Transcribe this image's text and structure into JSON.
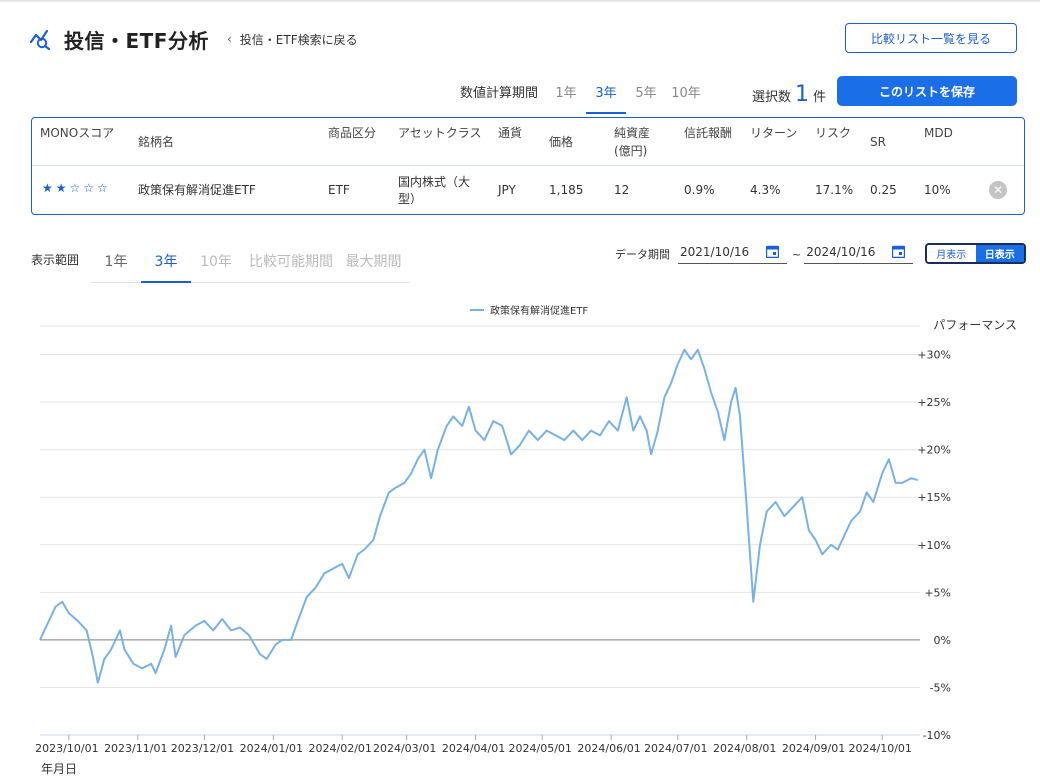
{
  "header": {
    "title": "投信・ETF分析",
    "back_label": "投信・ETF検索に戻る",
    "compare_list_button": "比較リスト一覧を見る"
  },
  "calc_period": {
    "label": "数値計算期間",
    "tabs": [
      "1年",
      "3年",
      "5年",
      "10年"
    ],
    "active": "3年"
  },
  "selection": {
    "label": "選択数",
    "count": "1",
    "unit": "件"
  },
  "save_button": "このリストを保存",
  "table": {
    "headers": {
      "mono_score": "MONOスコア",
      "name": "銘柄名",
      "category": "商品区分",
      "asset_class": "アセットクラス",
      "currency": "通貨",
      "price": "価格",
      "net_assets": "純資産",
      "net_assets_unit": "(億円)",
      "fee": "信託報酬",
      "return": "リターン",
      "risk": "リスク",
      "sr": "SR",
      "mdd": "MDD"
    },
    "rows": [
      {
        "stars": "★★☆☆☆",
        "name": "政策保有解消促進ETF",
        "category": "ETF",
        "asset_class": "国内株式（大型）",
        "currency": "JPY",
        "price": "1,185",
        "net_assets": "12",
        "fee": "0.9%",
        "return": "4.3%",
        "risk": "17.1%",
        "sr": "0.25",
        "mdd": "10%",
        "remove_icon": "close-circle-icon"
      }
    ]
  },
  "range": {
    "label": "表示範囲",
    "tabs": [
      "1年",
      "3年",
      "10年",
      "比較可能期間",
      "最大期間"
    ],
    "active": "3年"
  },
  "data_period": {
    "label": "データ期間",
    "from": "2021/10/16",
    "to": "2024/10/16",
    "separator": "~"
  },
  "view_toggle": {
    "monthly": "月表示",
    "daily": "日表示",
    "active": "daily"
  },
  "colors": {
    "accent": "#1a6ee8",
    "line": "#78b2e5"
  },
  "chart_data": {
    "type": "line",
    "title": "",
    "ylabel": "パフォーマンス",
    "xlabel": "年月日",
    "ylim": [
      -10,
      33
    ],
    "xlim": [
      "2023-09-18",
      "2024-10-18"
    ],
    "y_ticks": [
      30,
      25,
      20,
      15,
      10,
      5,
      0,
      -5,
      -10
    ],
    "y_tick_labels": [
      "+30%",
      "+25%",
      "+20%",
      "+15%",
      "+10%",
      "+5%",
      "0%",
      "-5%",
      "-10%"
    ],
    "x_ticks": [
      "2023-10-01",
      "2023-11-01",
      "2023-12-01",
      "2024-01-01",
      "2024-02-01",
      "2024-03-01",
      "2024-04-01",
      "2024-05-01",
      "2024-06-01",
      "2024-07-01",
      "2024-08-01",
      "2024-09-01",
      "2024-10-01"
    ],
    "x_tick_labels": [
      "2023/10/01",
      "2023/11/01",
      "2023/12/01",
      "2024/01/01",
      "2024/02/01",
      "2024/03/01",
      "2024/04/01",
      "2024/05/01",
      "2024/06/01",
      "2024/07/01",
      "2024/08/01",
      "2024/09/01",
      "2024/10/01"
    ],
    "grid": true,
    "legend_position": "top-center",
    "series": [
      {
        "name": "政策保有解消促進ETF",
        "points": [
          [
            "2023-09-18",
            0.0
          ],
          [
            "2023-09-21",
            1.5
          ],
          [
            "2023-09-25",
            3.5
          ],
          [
            "2023-09-28",
            4.0
          ],
          [
            "2023-10-01",
            2.8
          ],
          [
            "2023-10-05",
            2.0
          ],
          [
            "2023-10-09",
            1.0
          ],
          [
            "2023-10-12",
            -2.0
          ],
          [
            "2023-10-14",
            -4.5
          ],
          [
            "2023-10-17",
            -2.0
          ],
          [
            "2023-10-20",
            -1.0
          ],
          [
            "2023-10-24",
            1.0
          ],
          [
            "2023-10-26",
            -1.0
          ],
          [
            "2023-10-30",
            -2.5
          ],
          [
            "2023-11-03",
            -3.0
          ],
          [
            "2023-11-07",
            -2.5
          ],
          [
            "2023-11-09",
            -3.5
          ],
          [
            "2023-11-13",
            -1.0
          ],
          [
            "2023-11-16",
            1.5
          ],
          [
            "2023-11-18",
            -1.8
          ],
          [
            "2023-11-22",
            0.5
          ],
          [
            "2023-11-27",
            1.5
          ],
          [
            "2023-12-01",
            2.0
          ],
          [
            "2023-12-05",
            1.0
          ],
          [
            "2023-12-09",
            2.2
          ],
          [
            "2023-12-13",
            1.0
          ],
          [
            "2023-12-17",
            1.3
          ],
          [
            "2023-12-21",
            0.5
          ],
          [
            "2023-12-26",
            -1.5
          ],
          [
            "2023-12-29",
            -2.0
          ],
          [
            "2024-01-02",
            -0.5
          ],
          [
            "2024-01-05",
            0.0
          ],
          [
            "2024-01-09",
            0.0
          ],
          [
            "2024-01-12",
            2.0
          ],
          [
            "2024-01-16",
            4.5
          ],
          [
            "2024-01-20",
            5.5
          ],
          [
            "2024-01-24",
            7.0
          ],
          [
            "2024-01-28",
            7.5
          ],
          [
            "2024-02-01",
            8.0
          ],
          [
            "2024-02-04",
            6.5
          ],
          [
            "2024-02-08",
            9.0
          ],
          [
            "2024-02-11",
            9.5
          ],
          [
            "2024-02-15",
            10.5
          ],
          [
            "2024-02-18",
            13.0
          ],
          [
            "2024-02-22",
            15.5
          ],
          [
            "2024-02-25",
            16.0
          ],
          [
            "2024-02-29",
            16.5
          ],
          [
            "2024-03-03",
            17.5
          ],
          [
            "2024-03-06",
            19.0
          ],
          [
            "2024-03-09",
            20.0
          ],
          [
            "2024-03-12",
            17.0
          ],
          [
            "2024-03-15",
            20.0
          ],
          [
            "2024-03-19",
            22.5
          ],
          [
            "2024-03-22",
            23.5
          ],
          [
            "2024-03-26",
            22.5
          ],
          [
            "2024-03-29",
            24.5
          ],
          [
            "2024-04-01",
            22.0
          ],
          [
            "2024-04-05",
            21.0
          ],
          [
            "2024-04-09",
            23.0
          ],
          [
            "2024-04-13",
            22.5
          ],
          [
            "2024-04-17",
            19.5
          ],
          [
            "2024-04-21",
            20.5
          ],
          [
            "2024-04-25",
            22.0
          ],
          [
            "2024-04-29",
            21.0
          ],
          [
            "2024-05-03",
            22.0
          ],
          [
            "2024-05-07",
            21.5
          ],
          [
            "2024-05-11",
            21.0
          ],
          [
            "2024-05-15",
            22.0
          ],
          [
            "2024-05-19",
            21.0
          ],
          [
            "2024-05-23",
            22.0
          ],
          [
            "2024-05-27",
            21.5
          ],
          [
            "2024-05-31",
            23.0
          ],
          [
            "2024-06-04",
            22.0
          ],
          [
            "2024-06-08",
            25.5
          ],
          [
            "2024-06-11",
            22.0
          ],
          [
            "2024-06-14",
            23.5
          ],
          [
            "2024-06-17",
            22.0
          ],
          [
            "2024-06-19",
            19.5
          ],
          [
            "2024-06-22",
            22.0
          ],
          [
            "2024-06-25",
            25.5
          ],
          [
            "2024-06-28",
            27.0
          ],
          [
            "2024-07-01",
            29.0
          ],
          [
            "2024-07-04",
            30.5
          ],
          [
            "2024-07-07",
            29.5
          ],
          [
            "2024-07-10",
            30.5
          ],
          [
            "2024-07-13",
            28.5
          ],
          [
            "2024-07-16",
            26.0
          ],
          [
            "2024-07-19",
            24.0
          ],
          [
            "2024-07-22",
            21.0
          ],
          [
            "2024-07-25",
            25.0
          ],
          [
            "2024-07-27",
            26.5
          ],
          [
            "2024-07-29",
            23.5
          ],
          [
            "2024-08-01",
            14.0
          ],
          [
            "2024-08-04",
            4.0
          ],
          [
            "2024-08-07",
            10.0
          ],
          [
            "2024-08-10",
            13.5
          ],
          [
            "2024-08-14",
            14.5
          ],
          [
            "2024-08-18",
            13.0
          ],
          [
            "2024-08-22",
            14.0
          ],
          [
            "2024-08-26",
            15.0
          ],
          [
            "2024-08-29",
            11.5
          ],
          [
            "2024-09-01",
            10.5
          ],
          [
            "2024-09-04",
            9.0
          ],
          [
            "2024-09-08",
            10.0
          ],
          [
            "2024-09-11",
            9.5
          ],
          [
            "2024-09-14",
            11.0
          ],
          [
            "2024-09-17",
            12.5
          ],
          [
            "2024-09-21",
            13.5
          ],
          [
            "2024-09-24",
            15.5
          ],
          [
            "2024-09-27",
            14.5
          ],
          [
            "2024-10-01",
            17.5
          ],
          [
            "2024-10-04",
            19.0
          ],
          [
            "2024-10-07",
            16.5
          ],
          [
            "2024-10-10",
            16.5
          ],
          [
            "2024-10-14",
            17.0
          ],
          [
            "2024-10-17",
            16.8
          ]
        ]
      }
    ]
  }
}
